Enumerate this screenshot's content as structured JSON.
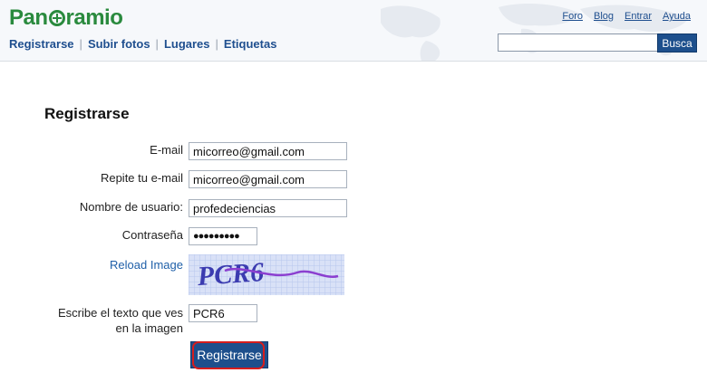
{
  "header": {
    "logo_text_1": "Pan",
    "logo_text_2": "ramio",
    "nav": [
      "Registrarse",
      "Subir fotos",
      "Lugares",
      "Etiquetas"
    ],
    "top_links": [
      "Foro",
      "Blog",
      "Entrar",
      "Ayuda"
    ],
    "search_placeholder": "",
    "search_button": "Busca"
  },
  "form": {
    "title": "Registrarse",
    "email_label": "E-mail",
    "email_value": "micorreo@gmail.com",
    "repeat_label": "Repite tu e-mail",
    "repeat_value": "micorreo@gmail.com",
    "username_label": "Nombre de usuario:",
    "username_value": "profedeciencias",
    "password_label": "Contraseña",
    "password_value": "●●●●●●●●●",
    "reload_label": "Reload Image",
    "captcha_text": "PCR6",
    "captcha_label_1": "Escribe el texto que ves",
    "captcha_label_2": "en la imagen",
    "captcha_value": "PCR6",
    "submit_label": "Registrarse"
  },
  "colors": {
    "brand_green": "#2a8a3e",
    "link_blue": "#1f4f8f",
    "button_blue": "#1d4f8c",
    "highlight_red": "#d51d1d"
  }
}
